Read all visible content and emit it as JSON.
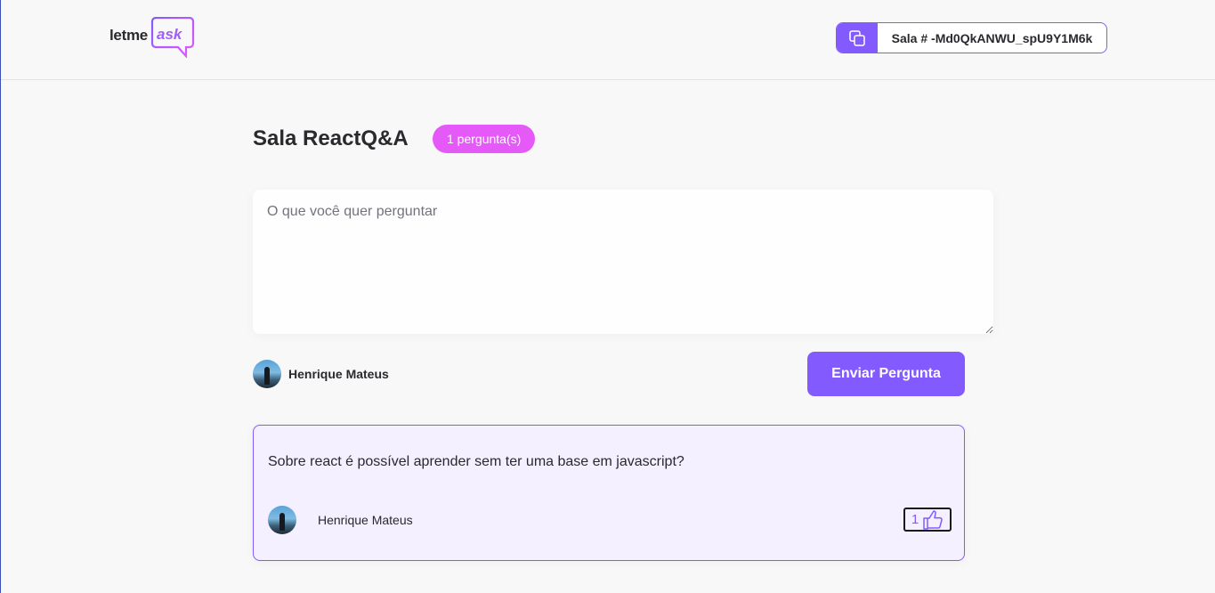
{
  "header": {
    "logo": {
      "part1": "letme",
      "part2": "ask"
    },
    "room_code": {
      "label": "Sala # -Md0QkANWU_spU9Y1M6k",
      "icon": "copy-icon"
    }
  },
  "room": {
    "title": "Sala ReactQ&A",
    "question_count_badge": "1 pergunta(s)"
  },
  "form": {
    "placeholder": "O que você quer perguntar",
    "user_name": "Henrique Mateus",
    "submit_label": "Enviar Pergunta"
  },
  "questions": [
    {
      "content": "Sobre react é possível aprender sem ter uma base em javascript?",
      "author": "Henrique Mateus",
      "like_count": "1",
      "like_icon": "thumbs-up-icon"
    }
  ],
  "colors": {
    "primary": "#835afd",
    "badge": "#e559f9",
    "background": "#f8f8f8",
    "card_highlight": "#f4f0ff",
    "text": "#29292e"
  }
}
